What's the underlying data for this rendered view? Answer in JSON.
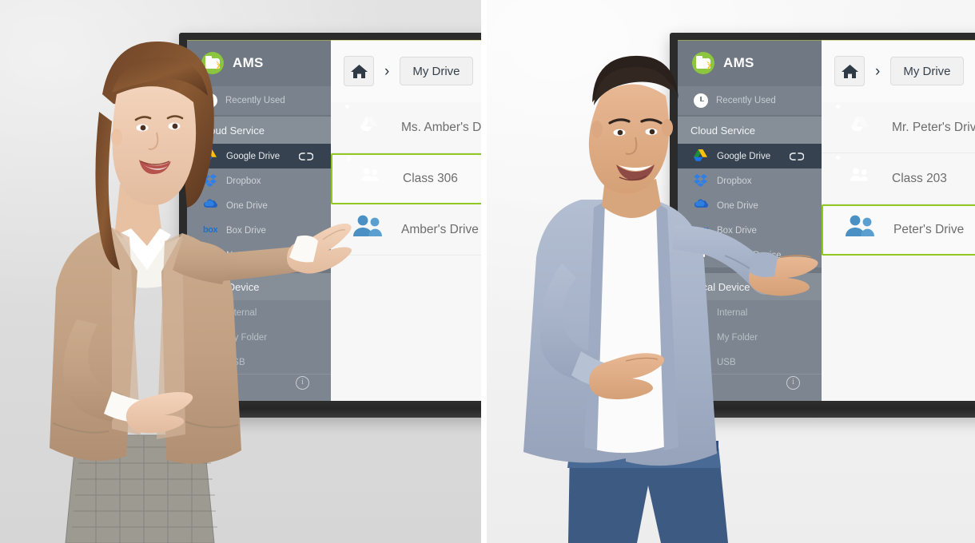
{
  "panels": [
    {
      "id": "left-panel",
      "person": "woman-presenter",
      "app": {
        "brand_name": "AMS",
        "brand_icon": "folder-wifi-logo",
        "recently_used": "Recently Used",
        "recently_used_icon": "clock-icon",
        "sections": [
          {
            "title": "Cloud Service",
            "items": [
              {
                "label": "Google Drive",
                "icon": "google-drive-icon",
                "active": true,
                "badge_icon": "link-icon"
              },
              {
                "label": "Dropbox",
                "icon": "dropbox-icon",
                "active": false
              },
              {
                "label": "One Drive",
                "icon": "onedrive-icon",
                "active": false
              },
              {
                "label": "Box Drive",
                "icon": "box-icon",
                "active": false
              },
              {
                "label": "Network Device",
                "icon": "network-device-icon",
                "active": false
              }
            ]
          },
          {
            "title": "Local Device",
            "items": [
              {
                "label": "Internal",
                "icon": "internal-storage-icon",
                "active": false
              },
              {
                "label": "My Folder",
                "icon": "folder-icon",
                "active": false
              },
              {
                "label": "USB",
                "icon": "usb-icon",
                "active": false
              }
            ]
          }
        ],
        "info_icon": "info-icon",
        "toolbar": {
          "home_icon": "home-icon",
          "separator_icon": "chevron-right-icon",
          "breadcrumb": "My Drive"
        },
        "files": [
          {
            "name": "Ms. Amber's Drive",
            "icon": "google-drive-shared-drive-icon",
            "icon_color": "#9a9a9a",
            "selected": false
          },
          {
            "name": "Class 306",
            "icon": "team-drive-icon",
            "icon_color": "#1fbd87",
            "selected": true
          },
          {
            "name": "Amber's Drive",
            "icon": "people-icon",
            "icon_color": "#4a90c4",
            "selected": false
          }
        ]
      }
    },
    {
      "id": "right-panel",
      "person": "man-presenter",
      "app": {
        "brand_name": "AMS",
        "brand_icon": "folder-wifi-logo",
        "recently_used": "Recently Used",
        "recently_used_icon": "clock-icon",
        "sections": [
          {
            "title": "Cloud Service",
            "items": [
              {
                "label": "Google Drive",
                "icon": "google-drive-icon",
                "active": true,
                "badge_icon": "link-icon"
              },
              {
                "label": "Dropbox",
                "icon": "dropbox-icon",
                "active": false
              },
              {
                "label": "One Drive",
                "icon": "onedrive-icon",
                "active": false
              },
              {
                "label": "Box Drive",
                "icon": "box-icon",
                "active": false
              },
              {
                "label": "Network Device",
                "icon": "network-device-icon",
                "active": false
              }
            ]
          },
          {
            "title": "Local Device",
            "items": [
              {
                "label": "Internal",
                "icon": "internal-storage-icon",
                "active": false
              },
              {
                "label": "My Folder",
                "icon": "folder-icon",
                "active": false
              },
              {
                "label": "USB",
                "icon": "usb-icon",
                "active": false
              }
            ]
          }
        ],
        "info_icon": "info-icon",
        "toolbar": {
          "home_icon": "home-icon",
          "separator_icon": "chevron-right-icon",
          "breadcrumb": "My Drive"
        },
        "files": [
          {
            "name": "Mr. Peter's Drive",
            "icon": "google-drive-shared-drive-icon",
            "icon_color": "#9a9a9a",
            "selected": false
          },
          {
            "name": "Class 203",
            "icon": "team-drive-icon",
            "icon_color": "#1fbd87",
            "selected": false
          },
          {
            "name": "Peter's Drive",
            "icon": "people-icon",
            "icon_color": "#4a90c4",
            "selected": true
          }
        ]
      }
    }
  ],
  "colors": {
    "selection_green": "#8ec820",
    "sidebar": "#7d8590",
    "sidebar_active": "#374250",
    "brand_green": "#8cc63f",
    "team_green": "#1fbd87",
    "people_blue": "#4a90c4",
    "bezel": "#2b2b2b"
  }
}
